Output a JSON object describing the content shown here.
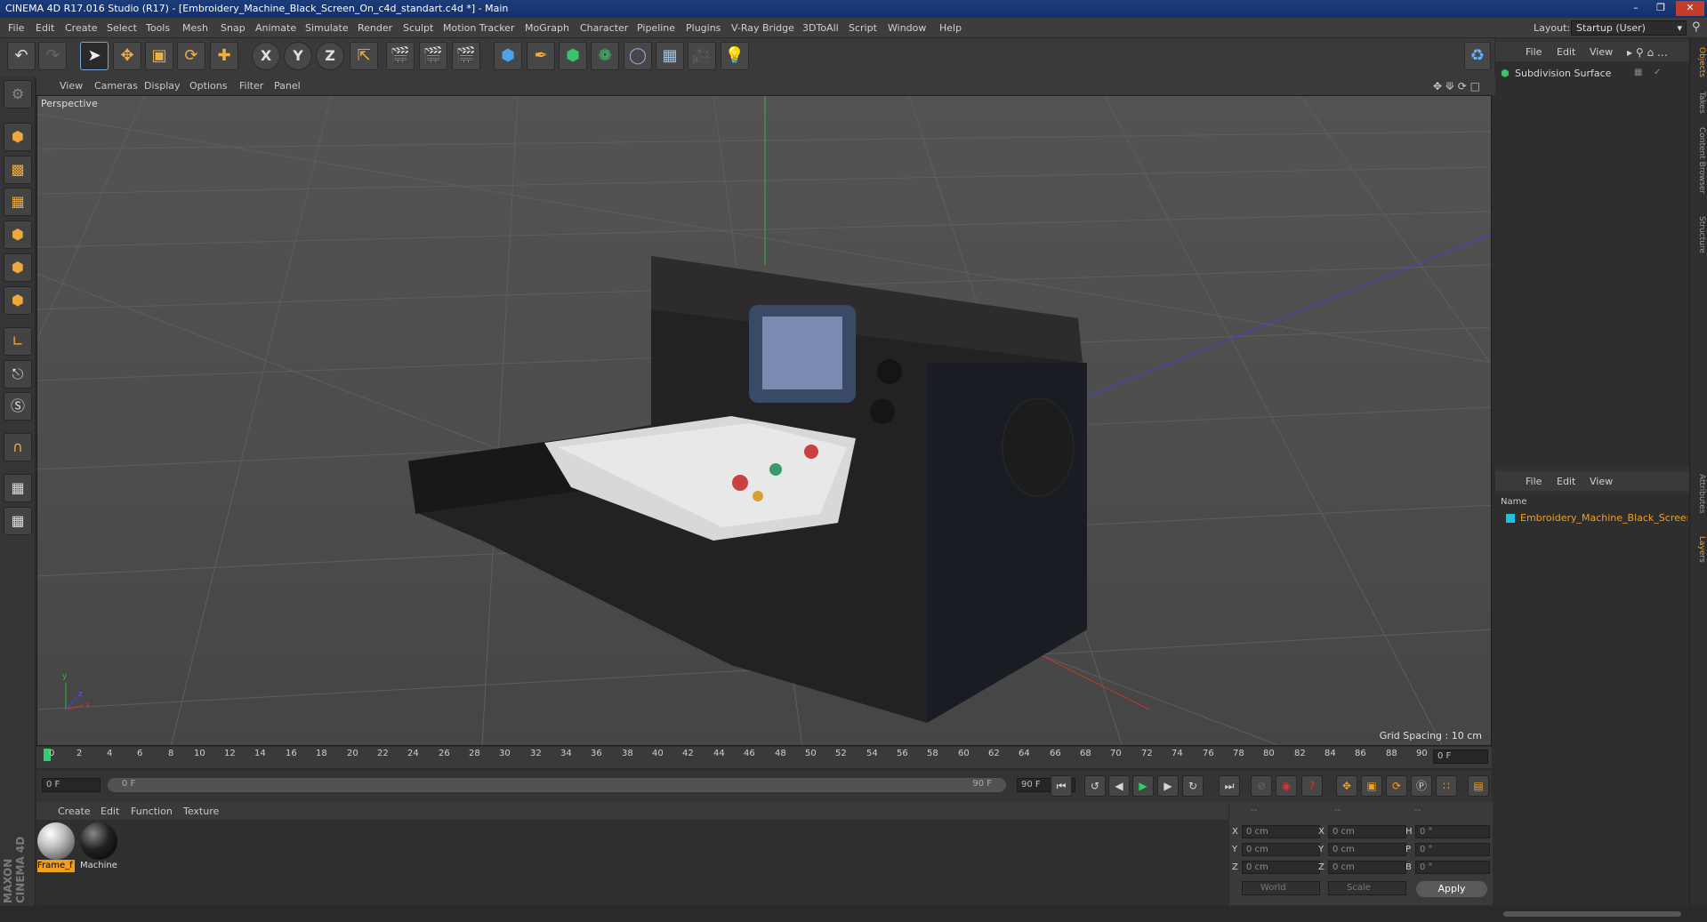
{
  "window": {
    "title": "CINEMA 4D R17.016 Studio (R17) - [Embroidery_Machine_Black_Screen_On_c4d_standart.c4d *] - Main"
  },
  "menu": [
    "File",
    "Edit",
    "Create",
    "Select",
    "Tools",
    "Mesh",
    "Snap",
    "Animate",
    "Simulate",
    "Render",
    "Sculpt",
    "Motion Tracker",
    "MoGraph",
    "Character",
    "Pipeline",
    "Plugins",
    "V-Ray Bridge",
    "3DToAll",
    "Script",
    "Window",
    "Help"
  ],
  "layout": {
    "label": "Layout:",
    "value": "Startup (User)"
  },
  "toolbar": {
    "undo_icon": "undo-icon",
    "redo_icon": "redo-icon",
    "axis_x": "X",
    "axis_y": "Y",
    "axis_z": "Z"
  },
  "viewport": {
    "menu": [
      "View",
      "Cameras",
      "Display",
      "Options",
      "Filter",
      "Panel"
    ],
    "label": "Perspective",
    "grid_spacing": "Grid Spacing : 10 cm",
    "axis_y_label": "y",
    "axis_x_label": "x",
    "axis_z_label": "z"
  },
  "timeline": {
    "ticks": [
      "0",
      "2",
      "4",
      "6",
      "8",
      "10",
      "12",
      "14",
      "16",
      "18",
      "20",
      "22",
      "24",
      "26",
      "28",
      "30",
      "32",
      "34",
      "36",
      "38",
      "40",
      "42",
      "44",
      "46",
      "48",
      "50",
      "52",
      "54",
      "56",
      "58",
      "60",
      "62",
      "64",
      "66",
      "68",
      "70",
      "72",
      "74",
      "76",
      "78",
      "80",
      "82",
      "84",
      "86",
      "88",
      "90"
    ],
    "current_frame": "0 F",
    "start_field": "0 F",
    "range_start": "0 F",
    "range_end": "90 F",
    "end_field": "90 F"
  },
  "materials": {
    "menu": [
      "Create",
      "Edit",
      "Function",
      "Texture"
    ],
    "items": [
      {
        "label": "Frame_f",
        "color": "#f0a020"
      },
      {
        "label": "Machine",
        "color": "#3a3a3a"
      }
    ]
  },
  "coords": {
    "header": [
      "--",
      "--",
      "--"
    ],
    "rows": [
      {
        "a": "X",
        "av": "0 cm",
        "b": "X",
        "bv": "0 cm",
        "c": "H",
        "cv": "0 °"
      },
      {
        "a": "Y",
        "av": "0 cm",
        "b": "Y",
        "bv": "0 cm",
        "c": "P",
        "cv": "0 °"
      },
      {
        "a": "Z",
        "av": "0 cm",
        "b": "Z",
        "bv": "0 cm",
        "c": "B",
        "cv": "0 °"
      }
    ],
    "world": "World",
    "scale": "Scale",
    "apply": "Apply"
  },
  "objects": {
    "menu": [
      "File",
      "Edit",
      "View"
    ],
    "items": [
      {
        "name": "Subdivision Surface"
      }
    ]
  },
  "layers": {
    "menu": [
      "File",
      "Edit",
      "View"
    ],
    "column": "Name",
    "items": [
      {
        "name": "Embroidery_Machine_Black_Screen"
      }
    ]
  },
  "side_tabs": [
    "Objects",
    "Takes",
    "Content Browser",
    "Structure",
    "Attributes",
    "Layers"
  ],
  "brand": "MAXON CINEMA 4D"
}
